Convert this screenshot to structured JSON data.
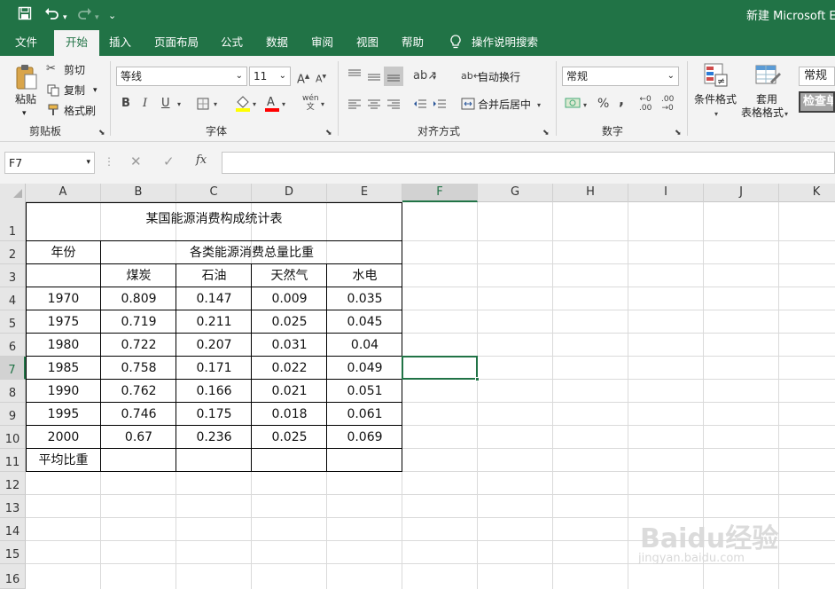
{
  "title_bar": {
    "title": "新建 Microsoft Ex"
  },
  "ribbon_tabs": [
    "文件",
    "开始",
    "插入",
    "页面布局",
    "公式",
    "数据",
    "审阅",
    "视图",
    "帮助",
    "操作说明搜索"
  ],
  "clipboard": {
    "paste": "粘贴",
    "cut": "剪切",
    "copy": "复制",
    "format_painter": "格式刷",
    "group": "剪贴板"
  },
  "font": {
    "name": "等线",
    "size": "11",
    "bold": "B",
    "italic": "I",
    "underline": "U",
    "group": "字体"
  },
  "alignment": {
    "wrap": "自动换行",
    "merge": "合并后居中",
    "group": "对齐方式"
  },
  "number": {
    "format": "常规",
    "percent": "%",
    "comma": ",",
    "group": "数字"
  },
  "styles": {
    "conditional": "条件格式",
    "table_fmt_1": "套用",
    "table_fmt_2": "表格格式",
    "style_normal": "常规",
    "style_check": "检查单"
  },
  "formula_bar": {
    "name_box": "F7",
    "fx": "fx",
    "value": ""
  },
  "columns": [
    "A",
    "B",
    "C",
    "D",
    "E",
    "F",
    "G",
    "H",
    "I",
    "J",
    "K"
  ],
  "rows": [
    "1",
    "2",
    "3",
    "4",
    "5",
    "6",
    "7",
    "8",
    "9",
    "10",
    "11",
    "12",
    "13",
    "14",
    "15",
    "16"
  ],
  "selected_cell": "F7",
  "sheet": {
    "title": "某国能源消费构成统计表",
    "year_header": "年份",
    "group_header": "各类能源消费总量比重",
    "energy_types": [
      "煤炭",
      "石油",
      "天然气",
      "水电"
    ],
    "data_rows": [
      [
        "1970",
        "0.809",
        "0.147",
        "0.009",
        "0.035"
      ],
      [
        "1975",
        "0.719",
        "0.211",
        "0.025",
        "0.045"
      ],
      [
        "1980",
        "0.722",
        "0.207",
        "0.031",
        "0.04"
      ],
      [
        "1985",
        "0.758",
        "0.171",
        "0.022",
        "0.049"
      ],
      [
        "1990",
        "0.762",
        "0.166",
        "0.021",
        "0.051"
      ],
      [
        "1995",
        "0.746",
        "0.175",
        "0.018",
        "0.061"
      ],
      [
        "2000",
        "0.67",
        "0.236",
        "0.025",
        "0.069"
      ]
    ],
    "average_label": "平均比重"
  },
  "watermark": {
    "brand": "Baidu经验",
    "url": "jingyan.baidu.com"
  },
  "colors": {
    "excel_green": "#217346",
    "ribbon_bg": "#f3f3f3",
    "header_bg": "#e6e6e6",
    "grid_line": "#dadada"
  }
}
